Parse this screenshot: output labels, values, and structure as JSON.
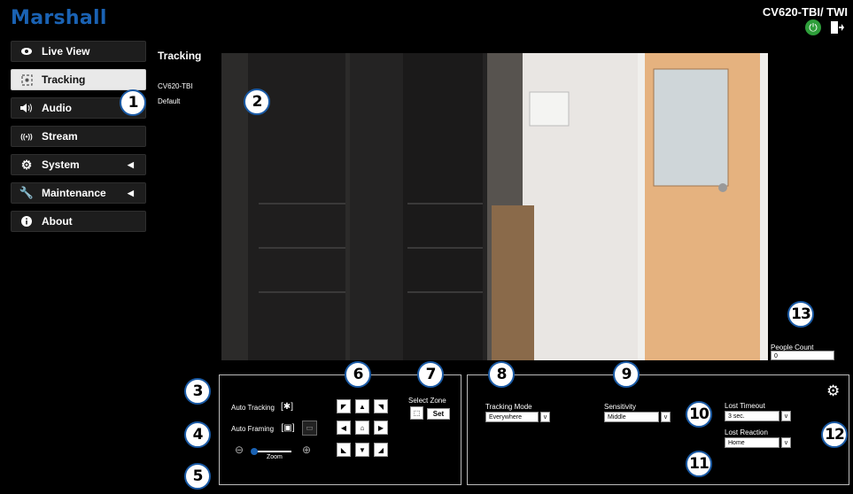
{
  "header": {
    "brand": "Marshall",
    "model": "CV620-TBI/ TWI"
  },
  "sidebar": {
    "items": [
      {
        "label": "Live View",
        "icon": "eye-icon"
      },
      {
        "label": "Tracking",
        "icon": "tracking-icon"
      },
      {
        "label": "Audio",
        "icon": "speaker-icon"
      },
      {
        "label": "Stream",
        "icon": "broadcast-icon"
      },
      {
        "label": "System",
        "icon": "gear-icon"
      },
      {
        "label": "Maintenance",
        "icon": "wrench-icon"
      },
      {
        "label": "About",
        "icon": "info-icon"
      }
    ]
  },
  "page": {
    "title": "Tracking",
    "camera_name": "CV620-TBI",
    "preset": "Default"
  },
  "people_count": {
    "label": "People Count",
    "value": "0"
  },
  "controls": {
    "auto_tracking": "Auto Tracking",
    "auto_framing": "Auto Framing",
    "zoom": "Zoom",
    "select_zone": "Select Zone",
    "set": "Set"
  },
  "settings": {
    "tracking_mode": {
      "label": "Tracking Mode",
      "value": "Everywhere"
    },
    "sensitivity": {
      "label": "Sensitivity",
      "value": "Middle"
    },
    "lost_timeout": {
      "label": "Lost Timeout",
      "value": "3 sec."
    },
    "lost_reaction": {
      "label": "Lost Reaction",
      "value": "Home"
    }
  },
  "callouts": [
    "1",
    "2",
    "3",
    "4",
    "5",
    "6",
    "7",
    "8",
    "9",
    "10",
    "11",
    "12",
    "13"
  ],
  "colors": {
    "brand": "#1a62b3",
    "power": "#2e9e3a",
    "callout_border": "#1a5aa5"
  }
}
